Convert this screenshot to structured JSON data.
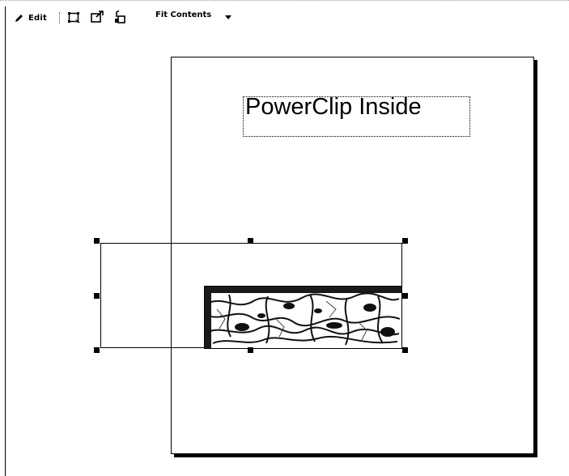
{
  "toolbar": {
    "edit_label": "Edit",
    "select_icon": "select-contents-icon",
    "extract_icon": "extract-contents-icon",
    "lock_icon": "lock-contents-icon",
    "fit_label": "Fit Contents",
    "fit_dropdown_icon": "chevron-down-icon"
  },
  "canvas": {
    "title_text": "PowerClip Inside"
  }
}
